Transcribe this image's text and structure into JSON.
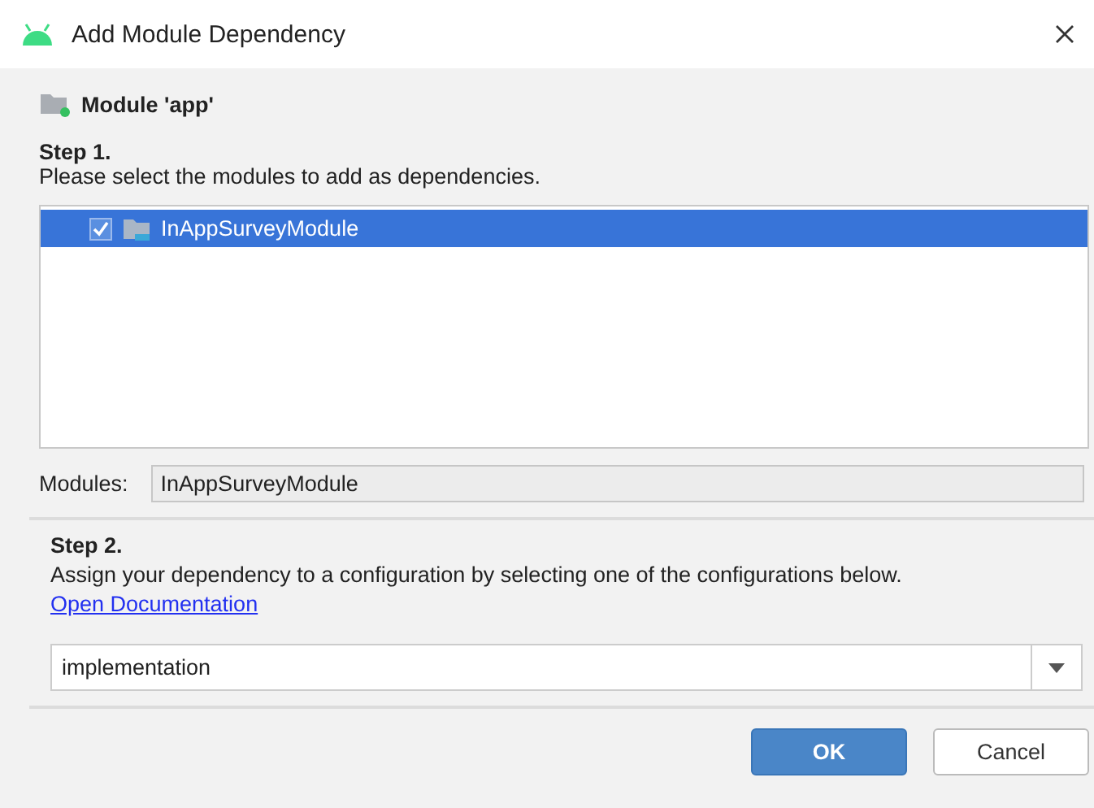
{
  "window": {
    "title": "Add Module Dependency"
  },
  "module": {
    "label": "Module 'app'"
  },
  "step1": {
    "heading": "Step 1.",
    "description": "Please select the modules to add as dependencies.",
    "modules": [
      {
        "name": "InAppSurveyModule",
        "checked": true,
        "selected": true
      }
    ],
    "modules_field": {
      "label": "Modules:",
      "value": "InAppSurveyModule"
    }
  },
  "step2": {
    "heading": "Step 2.",
    "description": "Assign your dependency to a configuration by selecting one of the configurations below.",
    "link": "Open Documentation",
    "configuration": {
      "value": "implementation"
    }
  },
  "buttons": [
    {
      "label": "OK",
      "default": true
    },
    {
      "label": "Cancel",
      "default": false
    }
  ]
}
